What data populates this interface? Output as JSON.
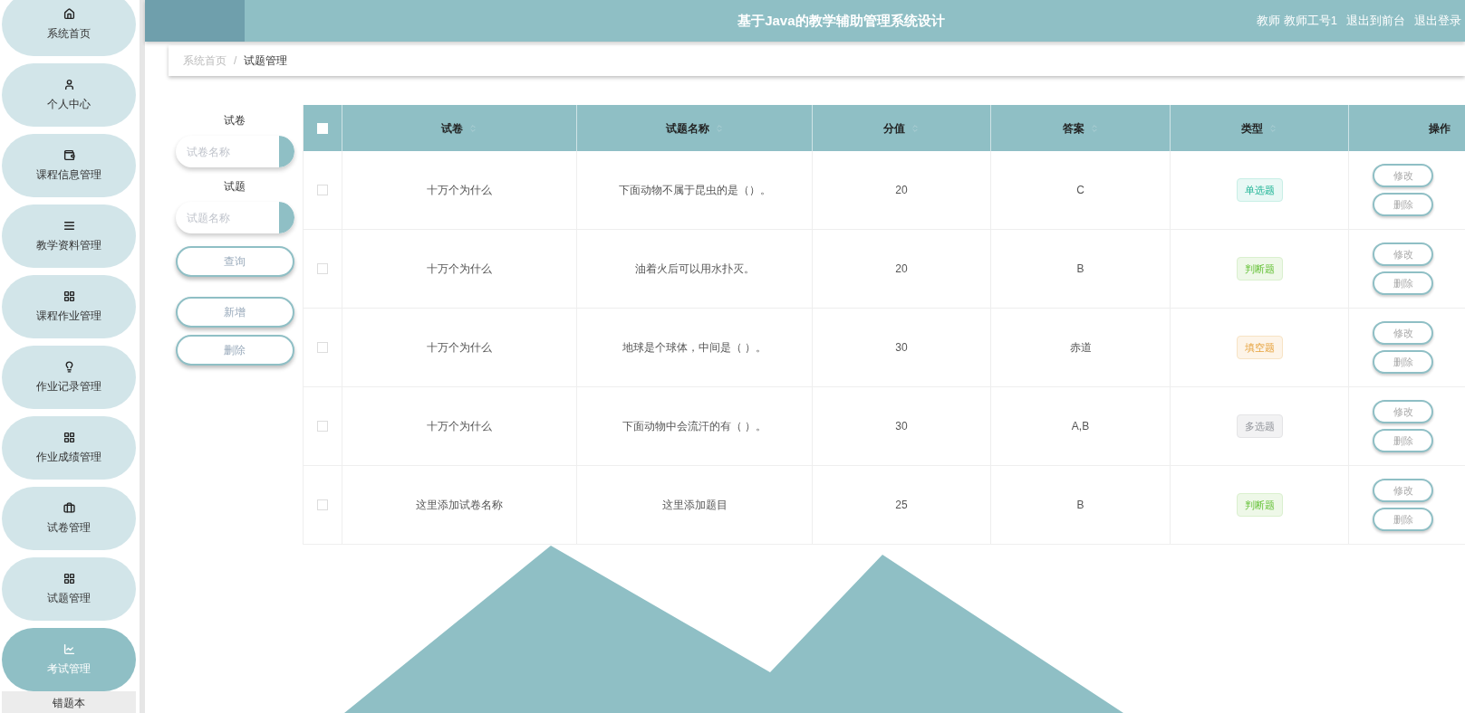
{
  "header": {
    "title": "基于Java的教学辅助管理系统设计",
    "user_role": "教师",
    "user_name": "教师工号1",
    "links": [
      "退出到前台",
      "退出登录"
    ]
  },
  "sidebar": {
    "items": [
      {
        "label": "系统首页",
        "selected": false
      },
      {
        "label": "个人中心",
        "selected": false
      },
      {
        "label": "课程信息管理",
        "selected": false
      },
      {
        "label": "教学资料管理",
        "selected": false
      },
      {
        "label": "课程作业管理",
        "selected": false
      },
      {
        "label": "作业记录管理",
        "selected": false
      },
      {
        "label": "作业成绩管理",
        "selected": false
      },
      {
        "label": "试卷管理",
        "selected": false
      },
      {
        "label": "试题管理",
        "selected": false
      },
      {
        "label": "考试管理",
        "selected": true,
        "children": [
          {
            "label": "错题本"
          }
        ]
      }
    ]
  },
  "breadcrumb": [
    "系统首页",
    "试题管理"
  ],
  "breadcrumb_separator": "/",
  "search": {
    "fields": [
      {
        "label": "试卷",
        "placeholder": "试卷名称"
      },
      {
        "label": "试题",
        "placeholder": "试题名称"
      }
    ],
    "query_button": "查询",
    "add_button": "新增",
    "delete_button": "删除"
  },
  "table": {
    "columns": [
      {
        "label": "试卷",
        "sortable": true
      },
      {
        "label": "试题名称",
        "sortable": true
      },
      {
        "label": "分值",
        "sortable": true
      },
      {
        "label": "答案",
        "sortable": true
      },
      {
        "label": "类型",
        "sortable": true
      },
      {
        "label": "操作",
        "sortable": false
      }
    ],
    "all_checked": false,
    "rows": [
      {
        "checked": false,
        "paper": "十万个为什么",
        "question": "下面动物不属于昆虫的是（）。",
        "score": "20",
        "answer": "C",
        "type": "单选题",
        "kind": "single",
        "edit_label": "修改",
        "delete_label": "删除"
      },
      {
        "checked": false,
        "paper": "十万个为什么",
        "question": "油着火后可以用水扑灭。",
        "score": "20",
        "answer": "B",
        "type": "判断题",
        "kind": "judge",
        "edit_label": "修改",
        "delete_label": "删除"
      },
      {
        "checked": false,
        "paper": "十万个为什么",
        "question": "地球是个球体，中间是（ ）。",
        "score": "30",
        "answer": "赤道",
        "type": "填空题",
        "kind": "fill",
        "edit_label": "修改",
        "delete_label": "删除"
      },
      {
        "checked": false,
        "paper": "十万个为什么",
        "question": "下面动物中会流汗的有（ ）。",
        "score": "30",
        "answer": "A,B",
        "type": "多选题",
        "kind": "multi",
        "edit_label": "修改",
        "delete_label": "删除"
      },
      {
        "checked": false,
        "paper": "这里添加试卷名称",
        "question": "这里添加题目",
        "score": "25",
        "answer": "B",
        "type": "判断题",
        "kind": "judge",
        "edit_label": "修改",
        "delete_label": "删除"
      }
    ]
  }
}
